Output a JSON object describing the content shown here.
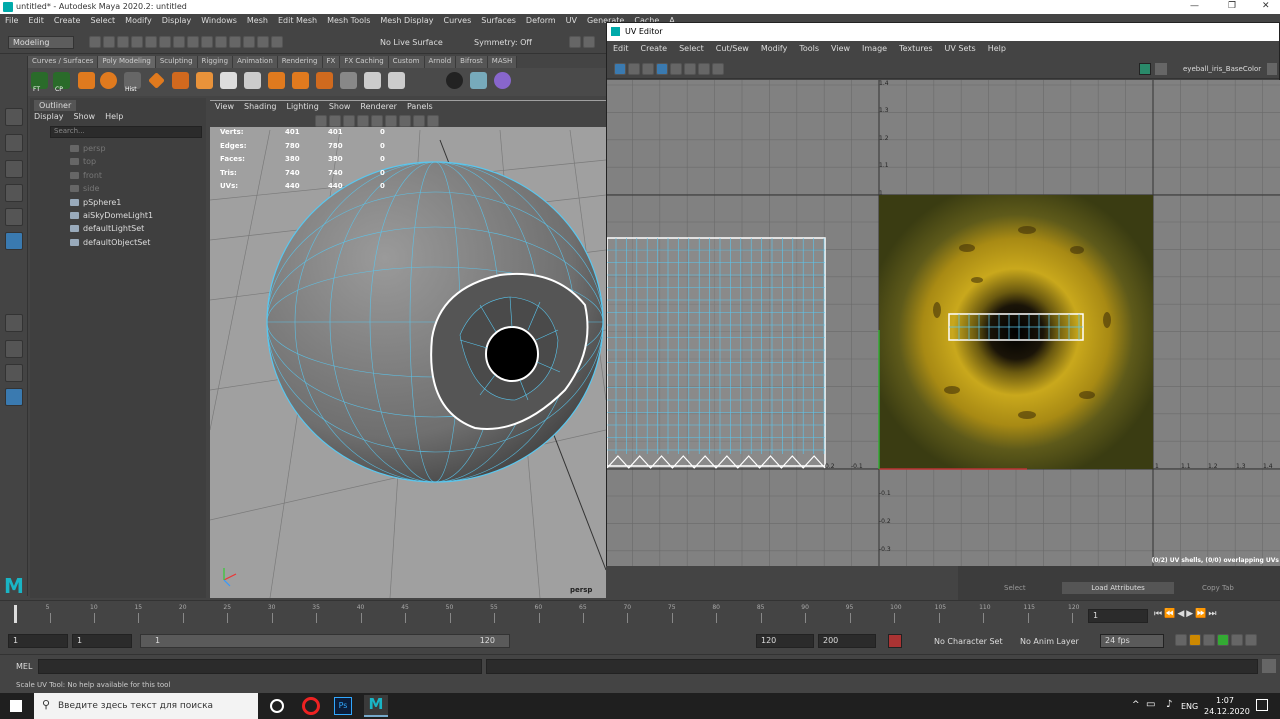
{
  "window": {
    "title": "untitled* - Autodesk Maya 2020.2: untitled"
  },
  "menubar": [
    "File",
    "Edit",
    "Create",
    "Select",
    "Modify",
    "Display",
    "Windows",
    "Mesh",
    "Edit Mesh",
    "Mesh Tools",
    "Mesh Display",
    "Curves",
    "Surfaces",
    "Deform",
    "UV",
    "Generate",
    "Cache",
    "A"
  ],
  "toolbar": {
    "mode": "Modeling",
    "live_surface": "No Live Surface",
    "symmetry": "Symmetry: Off"
  },
  "shelf_tabs": [
    "Curves / Surfaces",
    "Poly Modeling",
    "Sculpting",
    "Rigging",
    "Animation",
    "Rendering",
    "FX",
    "FX Caching",
    "Custom",
    "Arnold",
    "Bifrost",
    "MASH"
  ],
  "shelf_labels": {
    "ft": "FT",
    "cp": "CP",
    "hist": "Hist"
  },
  "outliner": {
    "title": "Outliner",
    "menu": [
      "Display",
      "Show",
      "Help"
    ],
    "search_placeholder": "Search...",
    "items": [
      {
        "label": "persp",
        "dim": true
      },
      {
        "label": "top",
        "dim": true
      },
      {
        "label": "front",
        "dim": true
      },
      {
        "label": "side",
        "dim": true
      },
      {
        "label": "pSphere1",
        "dim": false
      },
      {
        "label": "aiSkyDomeLight1",
        "dim": false
      },
      {
        "label": "defaultLightSet",
        "dim": false
      },
      {
        "label": "defaultObjectSet",
        "dim": false
      }
    ]
  },
  "viewport": {
    "menu": [
      "View",
      "Shading",
      "Lighting",
      "Show",
      "Renderer",
      "Panels"
    ],
    "camera_label": "persp",
    "hud": [
      {
        "label": "Verts:",
        "v1": "401",
        "v2": "401",
        "v3": "0"
      },
      {
        "label": "Edges:",
        "v1": "780",
        "v2": "780",
        "v3": "0"
      },
      {
        "label": "Faces:",
        "v1": "380",
        "v2": "380",
        "v3": "0"
      },
      {
        "label": "Tris:",
        "v1": "740",
        "v2": "740",
        "v3": "0"
      },
      {
        "label": "UVs:",
        "v1": "440",
        "v2": "440",
        "v3": "0"
      }
    ]
  },
  "uv_editor": {
    "title": "UV Editor",
    "menu": [
      "Edit",
      "Create",
      "Select",
      "Cut/Sew",
      "Modify",
      "Tools",
      "View",
      "Image",
      "Textures",
      "UV Sets",
      "Help"
    ],
    "texture_name": "eyeball_iris_BaseColor",
    "status": "(0/2) UV shells, (0/0) overlapping UVs",
    "v_ticks": [
      "1.4",
      "1.3",
      "1.2",
      "1.1",
      "1",
      "-0.1",
      "-0.2",
      "-0.3"
    ],
    "u_ticks": [
      "0.2",
      "-0.1",
      "1",
      "1.1",
      "1.2",
      "1.3",
      "1.4"
    ]
  },
  "attribute_panel": {
    "select": "Select",
    "load": "Load Attributes",
    "copy": "Copy Tab"
  },
  "timeline": {
    "ticks": [
      "5",
      "10",
      "15",
      "20",
      "25",
      "30",
      "35",
      "40",
      "45",
      "50",
      "55",
      "60",
      "65",
      "70",
      "75",
      "80",
      "85",
      "90",
      "95",
      "100",
      "105",
      "110",
      "115",
      "120"
    ],
    "current": "1"
  },
  "range": {
    "start": "1",
    "start2": "1",
    "slider_start": "1",
    "slider_end": "120",
    "end": "120",
    "end2": "200",
    "character_set": "No Character Set",
    "anim_layer": "No Anim Layer",
    "fps": "24 fps"
  },
  "mel": {
    "label": "MEL"
  },
  "status_line": "Scale UV Tool: No help available for this tool",
  "taskbar": {
    "search": "Введите здесь текст для поиска",
    "lang": "ENG",
    "time": "1:07",
    "date": "24.12.2020"
  }
}
